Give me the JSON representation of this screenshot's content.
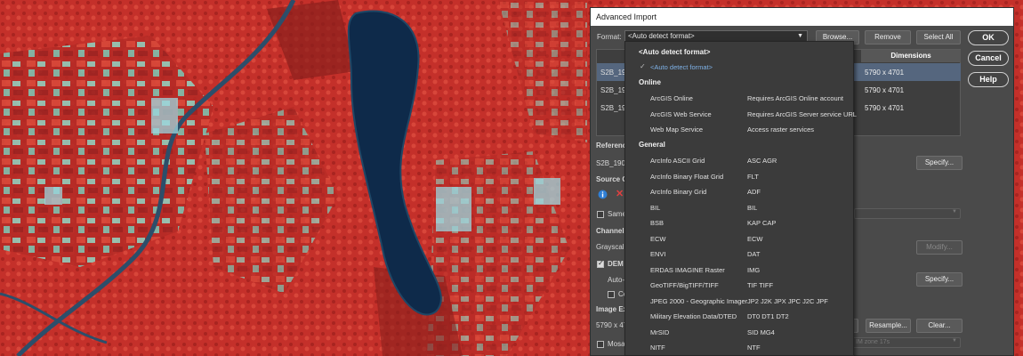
{
  "dialog": {
    "title": "Advanced Import",
    "format_label": "Format:",
    "format_value": "<Auto detect format>",
    "browse_label": "Browse...",
    "remove_label": "Remove",
    "select_all_label": "Select All",
    "ok_label": "OK",
    "cancel_label": "Cancel",
    "help_label": "Help"
  },
  "table": {
    "dimensions_header": "Dimensions",
    "rows": [
      {
        "name": "S2B_190",
        "dimensions": "5790 x 4701",
        "selected": true
      },
      {
        "name": "S2B_190",
        "dimensions": "5790 x 4701",
        "selected": false
      },
      {
        "name": "S2B_190",
        "dimensions": "5790 x 4701",
        "selected": false
      }
    ]
  },
  "reference": {
    "label": "Referenc",
    "value": "S2B_1906",
    "specify_label": "Specify..."
  },
  "source": {
    "label": "Source C",
    "same_label": "Same"
  },
  "channel": {
    "label": "Channel",
    "value": "Grayscale",
    "modify_label": "Modify..."
  },
  "dem": {
    "label": "DEM S",
    "auto_label": "Auto-s",
    "co_label": "Co",
    "specify_label": "Specify..."
  },
  "image_ext": {
    "label": "Image Ex",
    "value": "5790 x 47",
    "resample_label": "Resample...",
    "clear_label": "Clear..."
  },
  "mosaic": {
    "label": "Mosaic",
    "crs_value": "IM zone 17s"
  },
  "dropdown": {
    "header_item": "<Auto detect format>",
    "selected_item": "<Auto detect format>",
    "groups": [
      {
        "title": "Online",
        "items": [
          {
            "name": "ArcGIS Online",
            "ext": "Requires ArcGIS Online account"
          },
          {
            "name": "ArcGIS Web Service",
            "ext": "Requires ArcGIS Server service URL"
          },
          {
            "name": "Web Map Service",
            "ext": "Access raster services"
          }
        ]
      },
      {
        "title": "General",
        "items": [
          {
            "name": "ArcInfo ASCII Grid",
            "ext": "ASC AGR"
          },
          {
            "name": "ArcInfo Binary Float Grid",
            "ext": "FLT"
          },
          {
            "name": "ArcInfo Binary Grid",
            "ext": "ADF"
          },
          {
            "name": "BIL",
            "ext": "BIL"
          },
          {
            "name": "BSB",
            "ext": "KAP CAP"
          },
          {
            "name": "ECW",
            "ext": "ECW"
          },
          {
            "name": "ENVI",
            "ext": "DAT"
          },
          {
            "name": "ERDAS IMAGINE Raster",
            "ext": "IMG"
          },
          {
            "name": "GeoTIFF/BigTIFF/TIFF",
            "ext": "TIF TIFF"
          },
          {
            "name": "JPEG 2000 - Geographic Imager",
            "ext": "JP2 J2K JPX JPC J2C JPF"
          },
          {
            "name": "Military Elevation Data/DTED",
            "ext": "DT0 DT1 DT2"
          },
          {
            "name": "MrSID",
            "ext": "SID MG4"
          },
          {
            "name": "NITF",
            "ext": "NTF"
          }
        ]
      }
    ]
  },
  "colors": {
    "vegetation": "#c8332c",
    "lake": "#0e2a4a",
    "urban": "#8fd6c4",
    "dialog_bg": "#4a4a4a",
    "selection": "#55667e",
    "link_active": "#7fb2e8"
  }
}
